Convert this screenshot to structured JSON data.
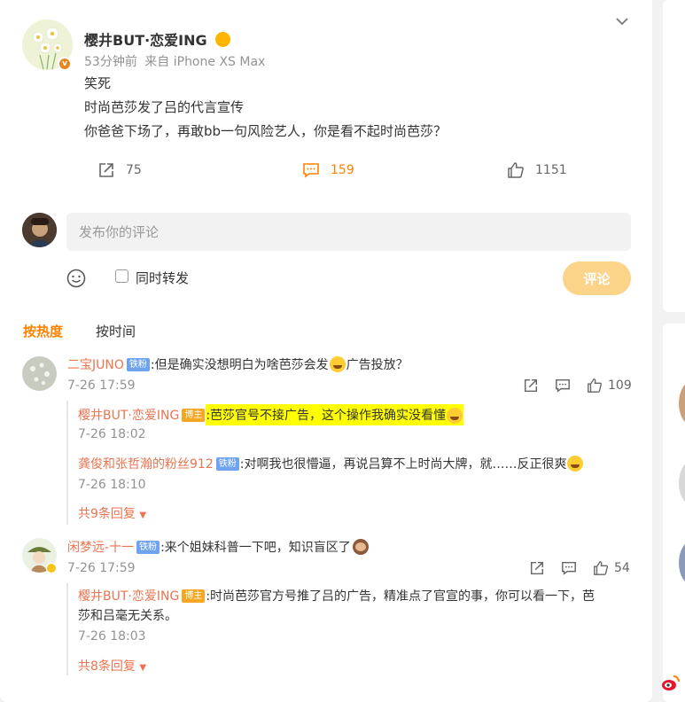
{
  "post": {
    "author": "樱井BUT·恋爱ING",
    "time": "53分钟前",
    "source": "来自 iPhone XS Max",
    "lines": [
      "笑死",
      "时尚芭莎发了吕的代言宣传",
      "你爸爸下场了，再敢bb一句风险艺人，你是看不起时尚芭莎？"
    ],
    "reposts": "75",
    "comments": "159",
    "likes": "1151"
  },
  "composer": {
    "placeholder": "发布你的评论",
    "repost_label": "同时转发",
    "submit_label": "评论"
  },
  "sort": {
    "hot": "按热度",
    "time": "按时间"
  },
  "comments": [
    {
      "user": "二宝JUNO",
      "tag": "铁粉",
      "text": ":但是确实没想明白为啥芭莎会发",
      "text_after": "广告投放？",
      "time": "7-26 17:59",
      "likes": "109",
      "replies": [
        {
          "user": "樱井BUT·恋爱ING",
          "tag": "博主",
          "text": ":芭莎官号不接广告，这个操作我确实没看懂",
          "time": "7-26 18:02"
        },
        {
          "user": "龚俊和张哲瀚的粉丝912",
          "tag": "铁粉",
          "text": ":对啊我也很懵逼，再说吕算不上时尚大牌，就……反正很爽",
          "time": "7-26 18:10"
        }
      ],
      "more": "共9条回复"
    },
    {
      "user": "闲梦远-十一",
      "tag": "铁粉",
      "text": ":来个姐妹科普一下吧，知识盲区了",
      "time": "7-26 17:59",
      "likes": "54",
      "replies": [
        {
          "user": "樱井BUT·恋爱ING",
          "tag": "博主",
          "text": ":时尚芭莎官方号推了吕的广告，精准点了官宣的事，你可以看一下，芭",
          "text2": "莎和吕毫无关系。",
          "time": "7-26 18:03"
        }
      ],
      "more": "共8条回复"
    }
  ],
  "colors": {
    "accent": "#ff8200",
    "username": "#eb7350",
    "highlight": "#ffff00",
    "submit": "#fbd389"
  }
}
